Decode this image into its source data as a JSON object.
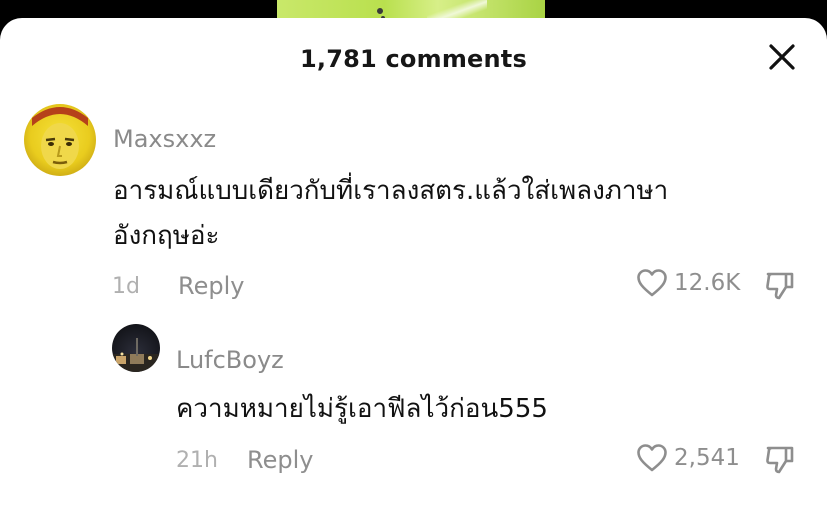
{
  "header": {
    "title": "1,781 comments"
  },
  "comments": [
    {
      "username": "Maxsxxz",
      "text_line1": "อารมณ์แบบเดียวกับที่เราลงสตร.แล้วใส่เพลงภาษา",
      "text_line2": "อังกฤษอ่ะ",
      "time": "1d",
      "reply_label": "Reply",
      "likes": "12.6K"
    },
    {
      "username": "LufcBoyz",
      "text_line1": "ความหมายไม่รู้เอาฟีลไว้ก่อน555",
      "time": "21h",
      "reply_label": "Reply",
      "likes": "2,541"
    }
  ],
  "colors": {
    "sheet": "#ffffff",
    "muted": "#8e8e8e",
    "text": "#111111"
  },
  "icons": [
    "close-icon",
    "heart-icon",
    "dislike-icon"
  ]
}
